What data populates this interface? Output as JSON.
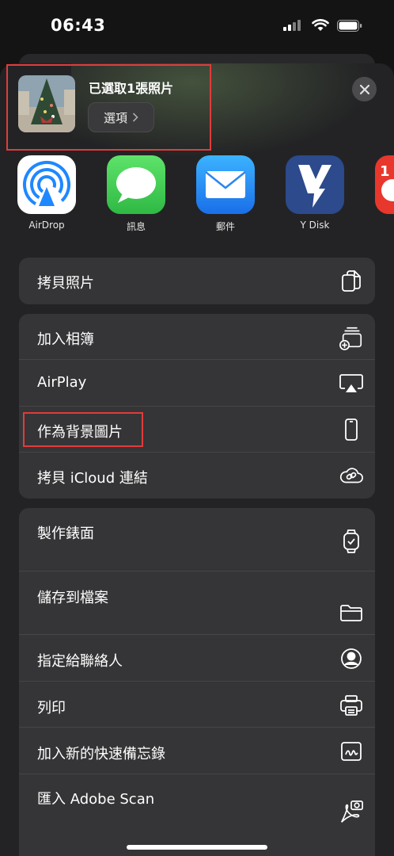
{
  "status": {
    "time": "06:43"
  },
  "header": {
    "selected_title": "已選取1張照片",
    "options_label": "選項",
    "close_icon": "close-icon"
  },
  "apps": [
    {
      "label": "AirDrop",
      "icon": "airdrop-icon",
      "color": "#1e88ff"
    },
    {
      "label": "訊息",
      "icon": "messages-icon",
      "color": "#34c759"
    },
    {
      "label": "郵件",
      "icon": "mail-icon",
      "color": "#1a8cff"
    },
    {
      "label": "Y Disk",
      "icon": "ydisk-icon",
      "color": "#2c4a8c"
    },
    {
      "label": "",
      "icon": "partial-app-icon",
      "color": "#e8372c"
    }
  ],
  "actions": {
    "group1": [
      {
        "label": "拷貝照片",
        "icon": "copy-icon"
      }
    ],
    "group2": [
      {
        "label": "加入相簿",
        "icon": "add-album-icon"
      },
      {
        "label": "AirPlay",
        "icon": "airplay-icon"
      },
      {
        "label": "作為背景圖片",
        "icon": "phone-icon"
      },
      {
        "label": "拷貝 iCloud 連結",
        "icon": "cloud-link-icon"
      }
    ],
    "group3": [
      {
        "label": "製作錶面",
        "icon": "watch-icon"
      },
      {
        "label": "儲存到檔案",
        "icon": "folder-icon"
      },
      {
        "label": "指定給聯絡人",
        "icon": "contact-icon"
      },
      {
        "label": "列印",
        "icon": "printer-icon"
      },
      {
        "label": "加入新的快速備忘錄",
        "icon": "quick-note-icon"
      },
      {
        "label": "匯入 Adobe Scan",
        "icon": "adobe-scan-icon"
      }
    ]
  },
  "colors": {
    "highlight": "#e03c3c",
    "sheet": "#232325",
    "row_bg": "#353537"
  }
}
